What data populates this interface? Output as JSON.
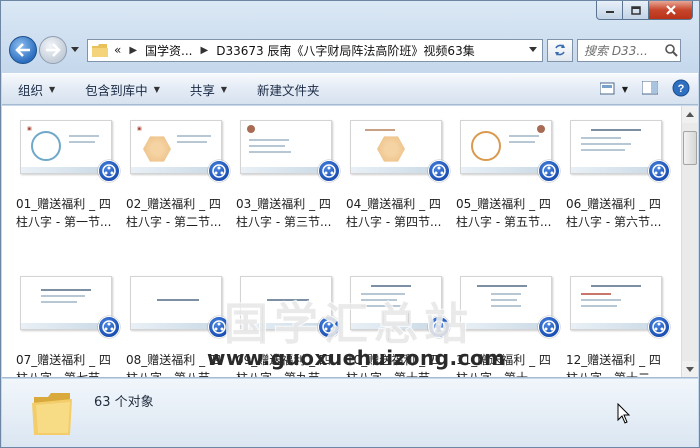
{
  "window": {
    "title_buttons": [
      "minimize",
      "maximize",
      "close"
    ]
  },
  "address_bar": {
    "overflow": "«",
    "crumbs": [
      "国学资...",
      "D33673 辰南《八字财局阵法高阶班》视频63集"
    ],
    "search_placeholder": "搜索 D33..."
  },
  "toolbar": {
    "organize": "组织",
    "include_in_library": "包含到库中",
    "share": "共享",
    "new_folder": "新建文件夹"
  },
  "files": [
    {
      "line1": "01_赠送福利 _ 四",
      "line2": "柱八字 - 第一节..."
    },
    {
      "line1": "02_赠送福利 _ 四",
      "line2": "柱八字 - 第二节..."
    },
    {
      "line1": "03_赠送福利 _ 四",
      "line2": "柱八字 - 第三节..."
    },
    {
      "line1": "04_赠送福利 _ 四",
      "line2": "柱八字 - 第四节..."
    },
    {
      "line1": "05_赠送福利 _ 四",
      "line2": "柱八字 - 第五节..."
    },
    {
      "line1": "06_赠送福利 _ 四",
      "line2": "柱八字 - 第六节..."
    },
    {
      "line1": "07_赠送福利 _ 四",
      "line2": "柱八字 - 第七节..."
    },
    {
      "line1": "08_赠送福利 _ 四",
      "line2": "柱八字 - 第八节..."
    },
    {
      "line1": "09_赠送福利 _ 四",
      "line2": "柱八字 - 第九节..."
    },
    {
      "line1": "10_赠送福利 _ 四",
      "line2": "柱八字 - 第十节..."
    },
    {
      "line1": "11_赠送福利 _ 四",
      "line2": "柱八字 - 第十一..."
    },
    {
      "line1": "12_赠送福利 _ 四",
      "line2": "柱八字 - 第十二..."
    }
  ],
  "watermark": {
    "title": "国学汇总站",
    "url": "www.guoxuehuizong.com"
  },
  "status": {
    "count": "63 个对象"
  },
  "colors": {
    "accent": "#2c6fc0",
    "close_button": "#c7452a",
    "toolbar_text": "#1b2b45"
  }
}
